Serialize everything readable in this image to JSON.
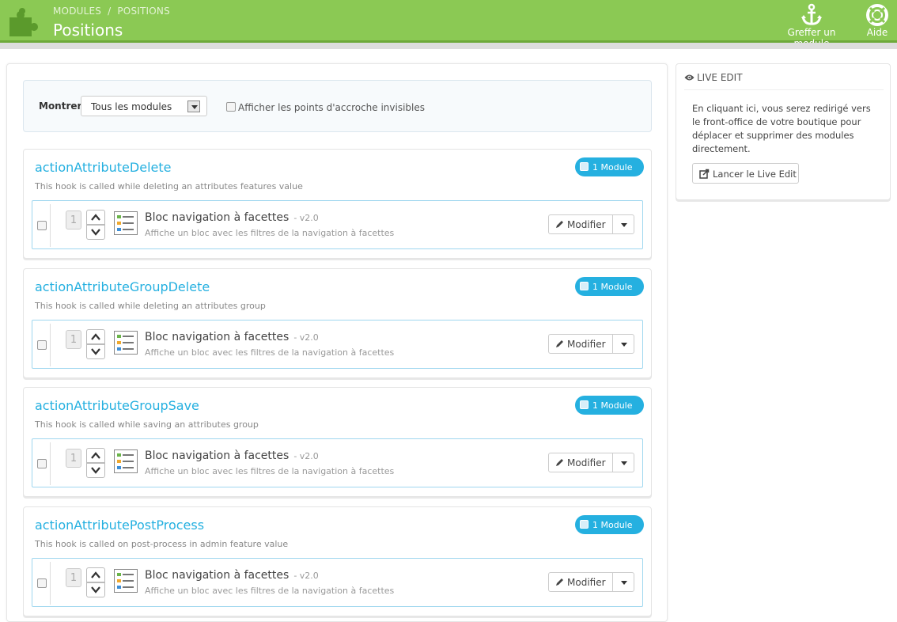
{
  "header": {
    "breadcrumb": [
      "MODULES",
      "POSITIONS"
    ],
    "breadcrumb_sep": "/",
    "title": "Positions",
    "actions": [
      {
        "label": "Greffer un module",
        "icon": "anchor-icon"
      },
      {
        "label": "Aide",
        "icon": "lifebuoy-icon"
      }
    ]
  },
  "filter": {
    "show_label": "Montrer",
    "show_selected": "Tous les modules",
    "invisible_hooks_label": "Afficher les points d'accroche invisibles"
  },
  "hooks": [
    {
      "name": "actionAttributeDelete",
      "description": "This hook is called while deleting an attributes features value",
      "badge": "1 Module",
      "module": {
        "position": "1",
        "name": "Bloc navigation à facettes",
        "version": "- v2.0",
        "description": "Affiche un bloc avec les filtres de la navigation à facettes",
        "edit_label": "Modifier"
      }
    },
    {
      "name": "actionAttributeGroupDelete",
      "description": "This hook is called while deleting an attributes group",
      "badge": "1 Module",
      "module": {
        "position": "1",
        "name": "Bloc navigation à facettes",
        "version": "- v2.0",
        "description": "Affiche un bloc avec les filtres de la navigation à facettes",
        "edit_label": "Modifier"
      }
    },
    {
      "name": "actionAttributeGroupSave",
      "description": "This hook is called while saving an attributes group",
      "badge": "1 Module",
      "module": {
        "position": "1",
        "name": "Bloc navigation à facettes",
        "version": "- v2.0",
        "description": "Affiche un bloc avec les filtres de la navigation à facettes",
        "edit_label": "Modifier"
      }
    },
    {
      "name": "actionAttributePostProcess",
      "description": "This hook is called on post-process in admin feature value",
      "badge": "1 Module",
      "module": {
        "position": "1",
        "name": "Bloc navigation à facettes",
        "version": "- v2.0",
        "description": "Affiche un bloc avec les filtres de la navigation à facettes",
        "edit_label": "Modifier"
      }
    }
  ],
  "live_edit": {
    "heading": "LIVE EDIT",
    "text": "En cliquant ici, vous serez redirigé vers le front-office de votre boutique pour déplacer et supprimer des modules directement.",
    "button_label": "Lancer le Live Edit"
  },
  "colors": {
    "header_green": "#8bc954",
    "accent_blue": "#25b0e0"
  }
}
